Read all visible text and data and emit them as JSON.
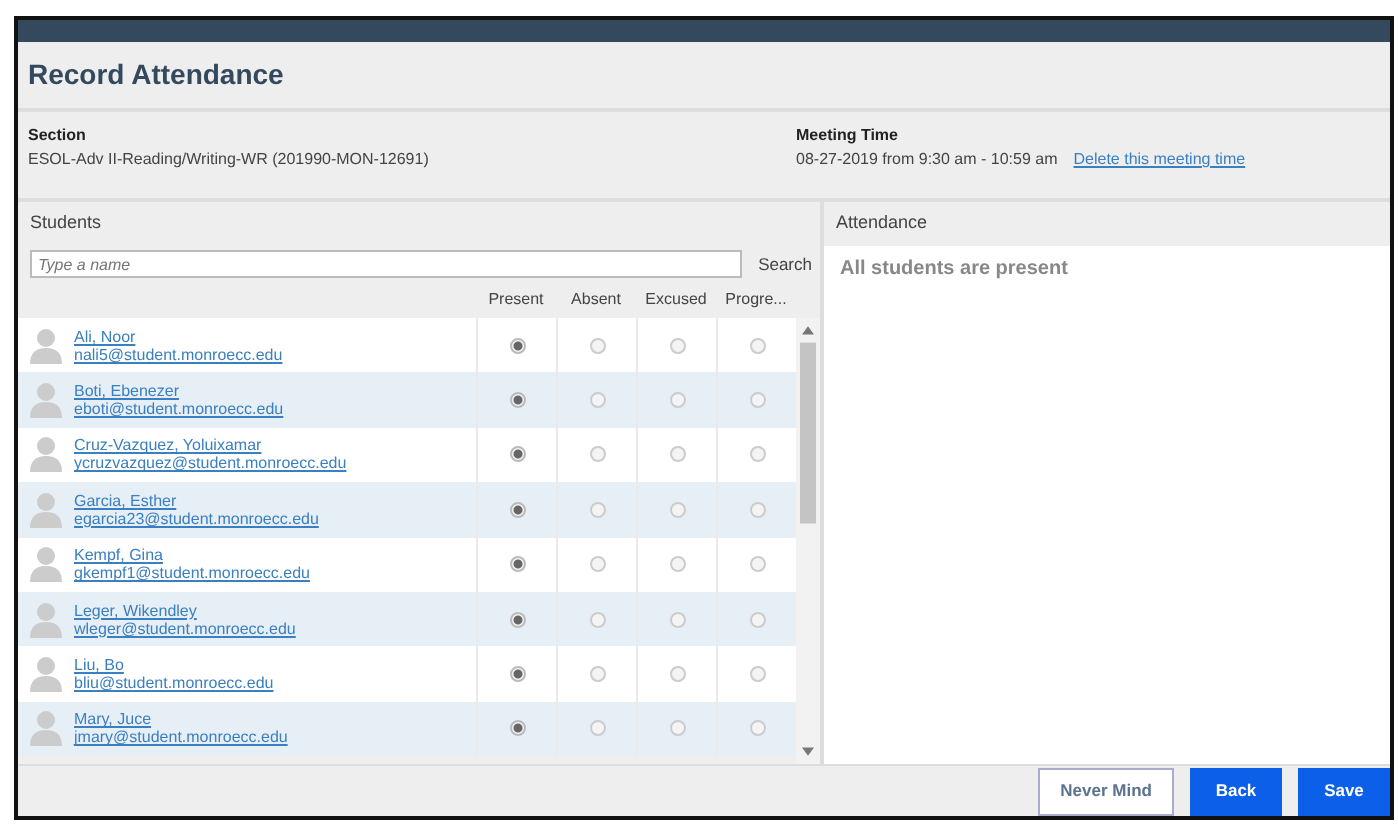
{
  "dialog": {
    "title": "Record Attendance"
  },
  "section": {
    "label": "Section",
    "value": "ESOL-Adv II-Reading/Writing-WR (201990-MON-12691)"
  },
  "meeting_time": {
    "label": "Meeting Time",
    "value": "08-27-2019 from 9:30 am - 10:59 am",
    "link": "Delete this meeting time"
  },
  "students_panel": {
    "title": "Students",
    "search_placeholder": "Type a name",
    "search_button": "Search",
    "columns": [
      "Present",
      "Absent",
      "Excused",
      "Progre..."
    ],
    "rows": [
      {
        "name": "Ali, Noor",
        "email": "nali5@student.monroecc.edu",
        "options": [
          {
            "selected": true
          },
          {
            "selected": false
          },
          {
            "selected": false
          },
          {
            "selected": false
          }
        ]
      },
      {
        "name": "Boti, Ebenezer",
        "email": "eboti@student.monroecc.edu",
        "options": [
          {
            "selected": true
          },
          {
            "selected": false
          },
          {
            "selected": false
          },
          {
            "selected": false
          }
        ]
      },
      {
        "name": "Cruz-Vazquez, Yoluixamar",
        "email": "ycruzvazquez@student.monroecc.edu",
        "options": [
          {
            "selected": true
          },
          {
            "selected": false
          },
          {
            "selected": false
          },
          {
            "selected": false
          }
        ]
      },
      {
        "name": "Garcia, Esther",
        "email": "egarcia23@student.monroecc.edu",
        "options": [
          {
            "selected": true
          },
          {
            "selected": false
          },
          {
            "selected": false
          },
          {
            "selected": false
          }
        ]
      },
      {
        "name": "Kempf, Gina",
        "email": "gkempf1@student.monroecc.edu",
        "options": [
          {
            "selected": true
          },
          {
            "selected": false
          },
          {
            "selected": false
          },
          {
            "selected": false
          }
        ]
      },
      {
        "name": "Leger, Wikendley",
        "email": "wleger@student.monroecc.edu",
        "options": [
          {
            "selected": true
          },
          {
            "selected": false
          },
          {
            "selected": false
          },
          {
            "selected": false
          }
        ]
      },
      {
        "name": "Liu, Bo",
        "email": "bliu@student.monroecc.edu",
        "options": [
          {
            "selected": true
          },
          {
            "selected": false
          },
          {
            "selected": false
          },
          {
            "selected": false
          }
        ]
      },
      {
        "name": "Mary, Juce",
        "email": "jmary@student.monroecc.edu",
        "options": [
          {
            "selected": true
          },
          {
            "selected": false
          },
          {
            "selected": false
          },
          {
            "selected": false
          }
        ]
      }
    ]
  },
  "attendance_panel": {
    "title": "Attendance",
    "message": "All students are present"
  },
  "buttons": [
    {
      "label": "Never Mind",
      "kind": "outline"
    },
    {
      "label": "Back",
      "kind": "primary"
    },
    {
      "label": "Save",
      "kind": "primary"
    }
  ]
}
